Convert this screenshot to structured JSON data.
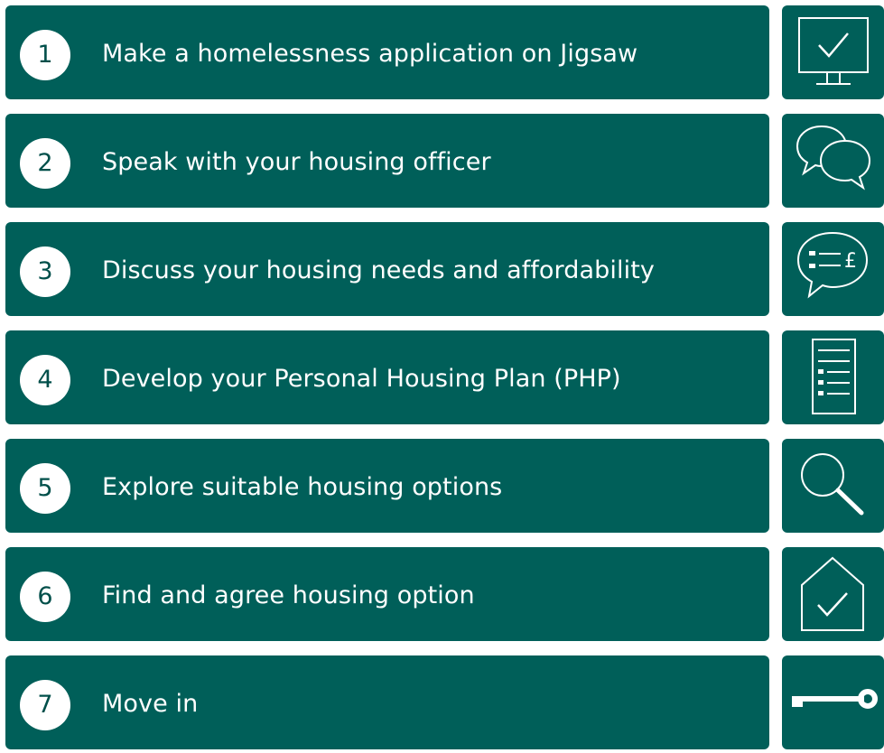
{
  "steps": [
    {
      "number": "1",
      "label": "Make a homelessness application on Jigsaw",
      "icon": "monitor-check-icon"
    },
    {
      "number": "2",
      "label": "Speak with your housing officer",
      "icon": "speech-bubbles-icon"
    },
    {
      "number": "3",
      "label": "Discuss your housing needs and affordability",
      "icon": "pound-speech-bubble-icon"
    },
    {
      "number": "4",
      "label": "Develop your Personal Housing Plan (PHP)",
      "icon": "checklist-document-icon"
    },
    {
      "number": "5",
      "label": "Explore suitable housing options",
      "icon": "magnifier-icon"
    },
    {
      "number": "6",
      "label": "Find and agree housing option",
      "icon": "house-check-icon"
    },
    {
      "number": "7",
      "label": "Move in",
      "icon": "key-icon"
    }
  ],
  "colors": {
    "bar": "#005f59",
    "circle": "#ffffff",
    "number": "#004f4a",
    "text": "#ffffff"
  }
}
